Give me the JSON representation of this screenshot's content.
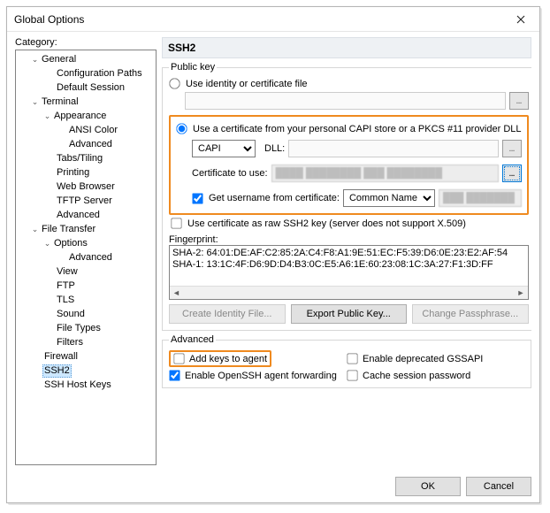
{
  "window": {
    "title": "Global Options"
  },
  "category_label": "Category:",
  "tree": {
    "general": "General",
    "config_paths": "Configuration Paths",
    "default_session": "Default Session",
    "terminal": "Terminal",
    "appearance": "Appearance",
    "ansi_color": "ANSI Color",
    "adv_appearance": "Advanced",
    "tabs_tiling": "Tabs/Tiling",
    "printing": "Printing",
    "web_browser": "Web Browser",
    "tftp": "TFTP Server",
    "term_adv": "Advanced",
    "file_transfer": "File Transfer",
    "options": "Options",
    "opt_adv": "Advanced",
    "view": "View",
    "ftp": "FTP",
    "tls": "TLS",
    "sound": "Sound",
    "file_types": "File Types",
    "filters": "Filters",
    "firewall": "Firewall",
    "ssh2": "SSH2",
    "ssh_host_keys": "SSH Host Keys"
  },
  "panel": {
    "heading": "SSH2",
    "pubkey_legend": "Public key",
    "radio_identity": "Use identity or certificate file",
    "radio_capi": "Use a certificate from your personal CAPI store or a PKCS #11 provider DLL",
    "capi_option": "CAPI",
    "dll_label": "DLL:",
    "cert_to_use": "Certificate to use:",
    "get_username": "Get username from certificate:",
    "common_name": "Common Name",
    "raw_ssh2": "Use certificate as raw SSH2 key (server does not support X.509)",
    "fp_label": "Fingerprint:",
    "fp_sha2": "SHA-2: 64:01:DE:AF:C2:85:2A:C4:F8:A1:9E:51:EC:F5:39:D6:0E:23:E2:AF:54",
    "fp_sha1": "SHA-1: 13:1C:4F:D6:9D:D4:B3:0C:E5:A6:1E:60:23:08:1C:3A:27:F1:3D:FF",
    "btn_create": "Create Identity File...",
    "btn_export": "Export Public Key...",
    "btn_change": "Change Passphrase...",
    "adv_legend": "Advanced",
    "add_keys": "Add keys to agent",
    "enable_gssapi": "Enable deprecated GSSAPI",
    "enable_fwd": "Enable OpenSSH agent forwarding",
    "cache_pwd": "Cache session password"
  },
  "footer": {
    "ok": "OK",
    "cancel": "Cancel"
  }
}
